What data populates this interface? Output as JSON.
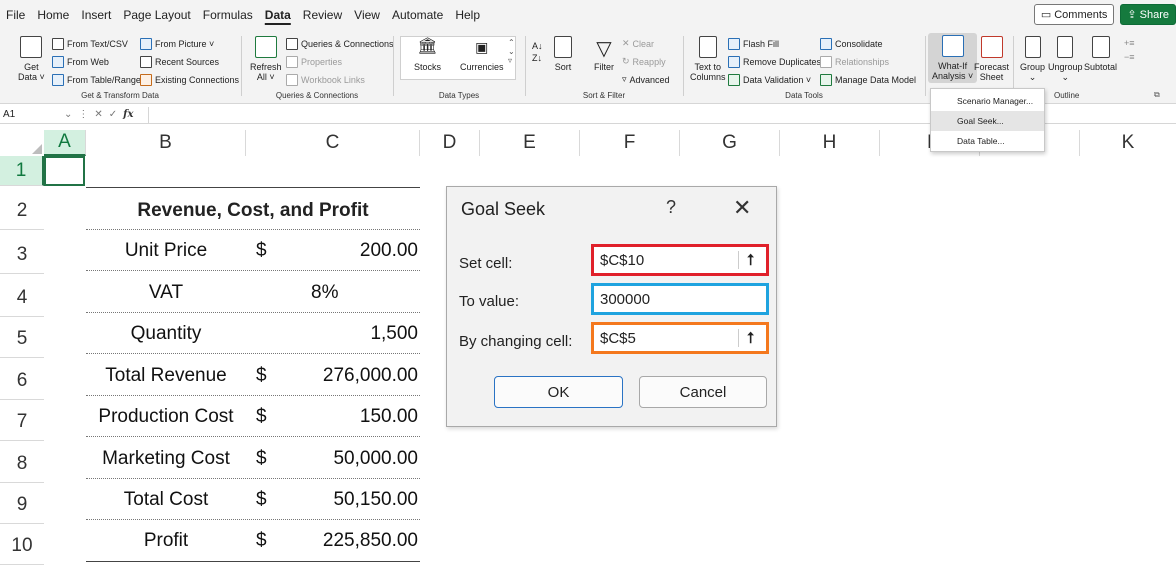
{
  "menu": {
    "items": [
      "File",
      "Home",
      "Insert",
      "Page Layout",
      "Formulas",
      "Data",
      "Review",
      "View",
      "Automate",
      "Help"
    ],
    "active_index": 5,
    "comments_label": "Comments",
    "share_label": "Share"
  },
  "ribbon": {
    "get_data": {
      "label_line1": "Get",
      "label_line2": "Data ˅"
    },
    "get_transform": {
      "from_text_csv": "From Text/CSV",
      "from_web": "From Web",
      "from_table_range": "From Table/Range",
      "from_picture": "From Picture ˅",
      "recent_sources": "Recent Sources",
      "existing_connections": "Existing Connections",
      "group_label": "Get & Transform Data"
    },
    "queries": {
      "refresh_line1": "Refresh",
      "refresh_line2": "All ˅",
      "queries_connections": "Queries & Connections",
      "properties": "Properties",
      "workbook_links": "Workbook Links",
      "group_label": "Queries & Connections"
    },
    "data_types": {
      "stocks": "Stocks",
      "currencies": "Currencies",
      "group_label": "Data Types"
    },
    "sort_filter": {
      "sort": "Sort",
      "filter": "Filter",
      "clear": "Clear",
      "reapply": "Reapply",
      "advanced": "Advanced",
      "group_label": "Sort & Filter"
    },
    "data_tools": {
      "text_to_columns_line1": "Text to",
      "text_to_columns_line2": "Columns",
      "flash_fill": "Flash Fill",
      "remove_duplicates": "Remove Duplicates",
      "data_validation": "Data Validation ˅",
      "consolidate": "Consolidate",
      "relationships": "Relationships",
      "manage_data_model": "Manage Data Model",
      "group_label": "Data Tools"
    },
    "forecast": {
      "what_if_line1": "What-If",
      "what_if_line2": "Analysis ˅",
      "forecast_line1": "Forecast",
      "forecast_line2": "Sheet"
    },
    "outline": {
      "group": "Group",
      "ungroup": "Ungroup",
      "subtotal": "Subtotal",
      "group_label": "Outline"
    }
  },
  "whatif_menu": {
    "items": [
      "Scenario Manager...",
      "Goal Seek...",
      "Data Table..."
    ],
    "highlighted_index": 1
  },
  "formula_bar": {
    "name_box": "A1",
    "fx": "fx",
    "value": ""
  },
  "columns": [
    "A",
    "B",
    "C",
    "D",
    "E",
    "F",
    "G",
    "H",
    "I",
    "J",
    "K"
  ],
  "rows": [
    "1",
    "2",
    "3",
    "4",
    "5",
    "6",
    "7",
    "8",
    "9",
    "10"
  ],
  "table": {
    "title": "Revenue, Cost, and Profit",
    "rows": [
      {
        "label": "Unit Price",
        "currency": "$",
        "value": "200.00"
      },
      {
        "label": "VAT",
        "currency": "",
        "value": "8%"
      },
      {
        "label": "Quantity",
        "currency": "",
        "value": "1,500"
      },
      {
        "label": "Total Revenue",
        "currency": "$",
        "value": "276,000.00"
      },
      {
        "label": "Production Cost",
        "currency": "$",
        "value": "150.00"
      },
      {
        "label": "Marketing Cost",
        "currency": "$",
        "value": "50,000.00"
      },
      {
        "label": "Total Cost",
        "currency": "$",
        "value": "50,150.00"
      },
      {
        "label": "Profit",
        "currency": "$",
        "value": "225,850.00"
      }
    ]
  },
  "goal_seek": {
    "title": "Goal Seek",
    "help": "?",
    "close": "✕",
    "set_cell_label": "Set cell:",
    "set_cell_value": "$C$10",
    "to_value_label": "To value:",
    "to_value_value": "300000",
    "changing_cell_label": "By changing cell:",
    "changing_cell_value": "$C$5",
    "ok_label": "OK",
    "cancel_label": "Cancel",
    "highlight_colors": {
      "set_cell": "#e0202a",
      "to_value": "#1fa3df",
      "changing_cell": "#f4781e"
    }
  },
  "colors": {
    "excel_green": "#217346",
    "share_green": "#157a3e"
  }
}
